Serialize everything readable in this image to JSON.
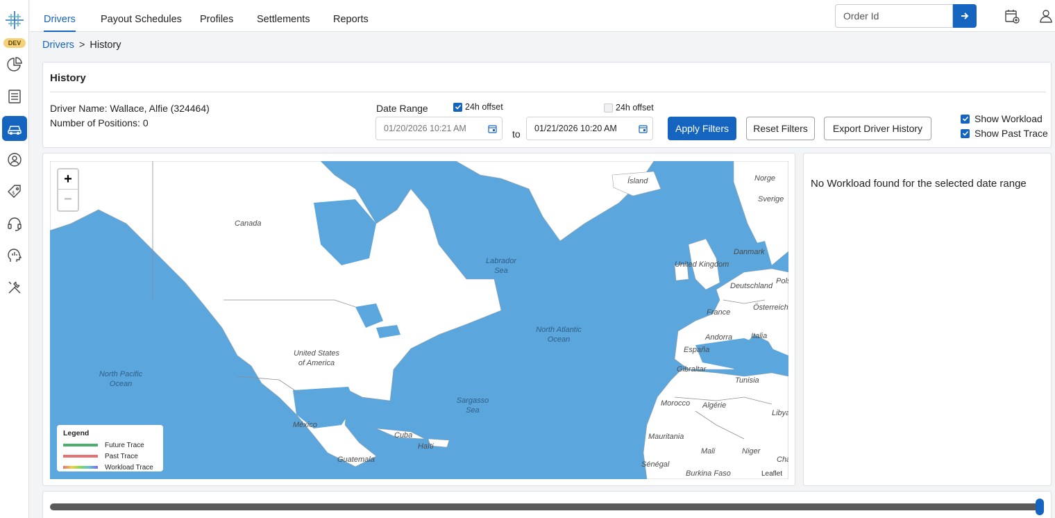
{
  "app": {
    "env_badge": "DEV",
    "colors": {
      "accent": "#1565c0",
      "water": "#5ba6dc",
      "land": "#ffffff"
    },
    "rail_icons": [
      "logo-icon",
      "pie-chart-icon",
      "document-list-icon",
      "car-icon",
      "user-circle-icon",
      "price-tag-icon",
      "headset-icon",
      "analytics-head-icon",
      "tools-icon"
    ]
  },
  "nav": {
    "tabs": [
      "Drivers",
      "Payout Schedules",
      "Profiles",
      "Settlements",
      "Reports"
    ],
    "active_tab": "Drivers",
    "order_search": {
      "placeholder": "Order Id",
      "value": ""
    }
  },
  "breadcrumb": {
    "parent": "Drivers",
    "separator": ">",
    "current": "History"
  },
  "history": {
    "title": "History",
    "driver_name": "Driver Name: Wallace, Alfie (324464)",
    "positions": "Number of Positions: 0",
    "date_range_label": "Date Range",
    "from_offset": {
      "label": "24h offset",
      "checked": true
    },
    "to_offset": {
      "label": "24h offset",
      "checked": false
    },
    "from_date": "01/20/2026 10:21 AM",
    "to_label": "to",
    "to_date": "01/21/2026 10:20 AM",
    "apply": "Apply Filters",
    "reset": "Reset Filters",
    "export": "Export Driver History",
    "show_workload": {
      "label": "Show Workload",
      "checked": true
    },
    "show_past_trace": {
      "label": "Show Past Trace",
      "checked": true
    }
  },
  "map": {
    "zoom_in": "+",
    "zoom_out": "−",
    "labels": {
      "canada": "Canada",
      "usa": "United States of America",
      "mexico": "México",
      "north_pacific": "North Pacific Ocean",
      "labrador": "Labrador Sea",
      "north_atlantic": "North Atlantic Ocean",
      "sargasso": "Sargasso Sea",
      "island": "Ísland",
      "norge": "Norge",
      "sverige": "Sverige",
      "danmark": "Danmark",
      "uk": "United Kingdom",
      "deutschland": "Deutschland",
      "polska": "Pols",
      "osterreich": "Österreich",
      "france": "France",
      "andorra": "Andorra",
      "espana": "España",
      "italia": "Italia",
      "gibraltar": "Gibraltar",
      "tunisia": "Tunisia",
      "morocco": "Morocco",
      "algerie": "Algérie",
      "libya": "Libya",
      "mauritania": "Mauritania",
      "mali": "Mali",
      "niger": "Niger",
      "chad": "Cha",
      "senegal": "Sénégal",
      "burkina": "Burkina Faso",
      "cuba": "Cuba",
      "haiti": "Haïti",
      "guatemala": "Guatemala"
    },
    "legend": {
      "title": "Legend",
      "items": [
        {
          "label": "Future Trace",
          "color": "#4caf6e"
        },
        {
          "label": "Past Trace",
          "color": "#e57373"
        },
        {
          "label": "Workload Trace",
          "color": "gradient"
        }
      ]
    },
    "attribution": "Leaflet"
  },
  "workload": {
    "message": "No Workload found for the selected date range"
  },
  "timeline": {
    "position_fraction": 1.0
  }
}
